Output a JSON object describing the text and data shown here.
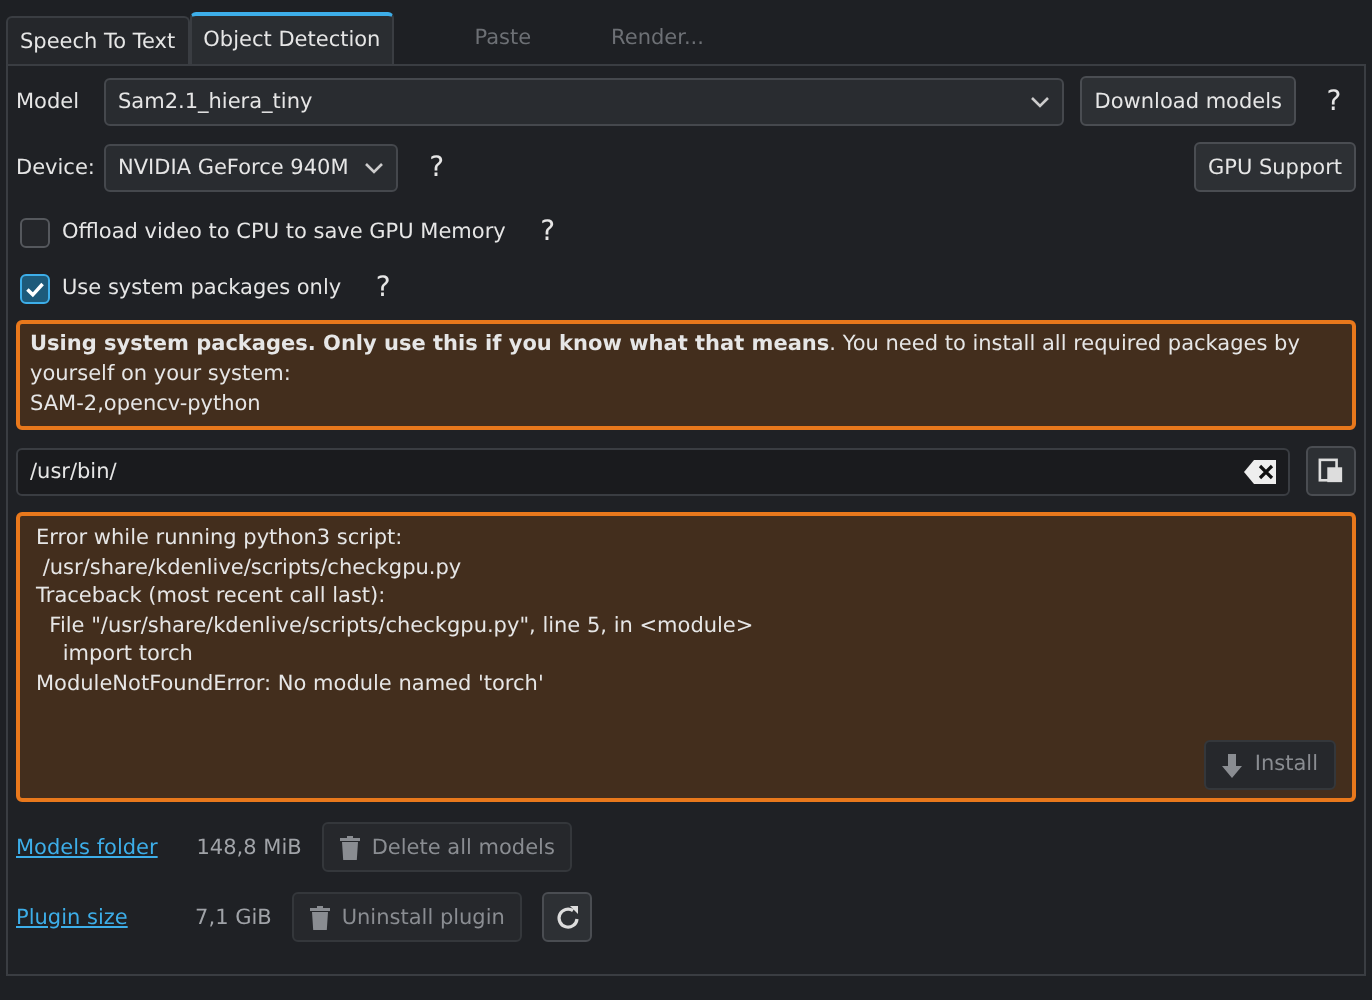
{
  "tabs": [
    {
      "label": "Speech To Text",
      "selected": false
    },
    {
      "label": "Object Detection",
      "selected": true
    }
  ],
  "background_toolbar": [
    "Paste",
    "Render..."
  ],
  "model": {
    "label": "Model",
    "value": "Sam2.1_hiera_tiny",
    "button": "Download models",
    "help": "?"
  },
  "device": {
    "label": "Device:",
    "value": "NVIDIA GeForce 940M",
    "help": "?",
    "button": "GPU Support"
  },
  "options": [
    {
      "label": "Offload video to CPU to save GPU Memory",
      "checked": false,
      "help": "?"
    },
    {
      "label": "Use system packages only",
      "checked": true,
      "help": "?"
    }
  ],
  "warning": {
    "text": "**Using system packages. Only use this if you know what that means**. You need to install all required packages by yourself on your system:",
    "packages": "SAM-2,opencv-python"
  },
  "path_field": {
    "value": "/usr/bin/"
  },
  "error": {
    "lines": [
      "Error while running python3 script:",
      " /usr/share/kdenlive/scripts/checkgpu.py",
      "Traceback (most recent call last):",
      "  File \"/usr/share/kdenlive/scripts/checkgpu.py\", line 5, in <module>",
      "    import torch",
      "ModuleNotFoundError: No module named 'torch'"
    ],
    "button": "Install",
    "button_disabled": true
  },
  "storage": [
    {
      "link": "Models folder",
      "size": "148,8 MiB",
      "button": "Delete all models",
      "disabled": true,
      "refresh": false
    },
    {
      "link": "Plugin size",
      "size": "7,1 GiB",
      "button": "Uninstall plugin",
      "disabled": true,
      "refresh": true
    }
  ]
}
